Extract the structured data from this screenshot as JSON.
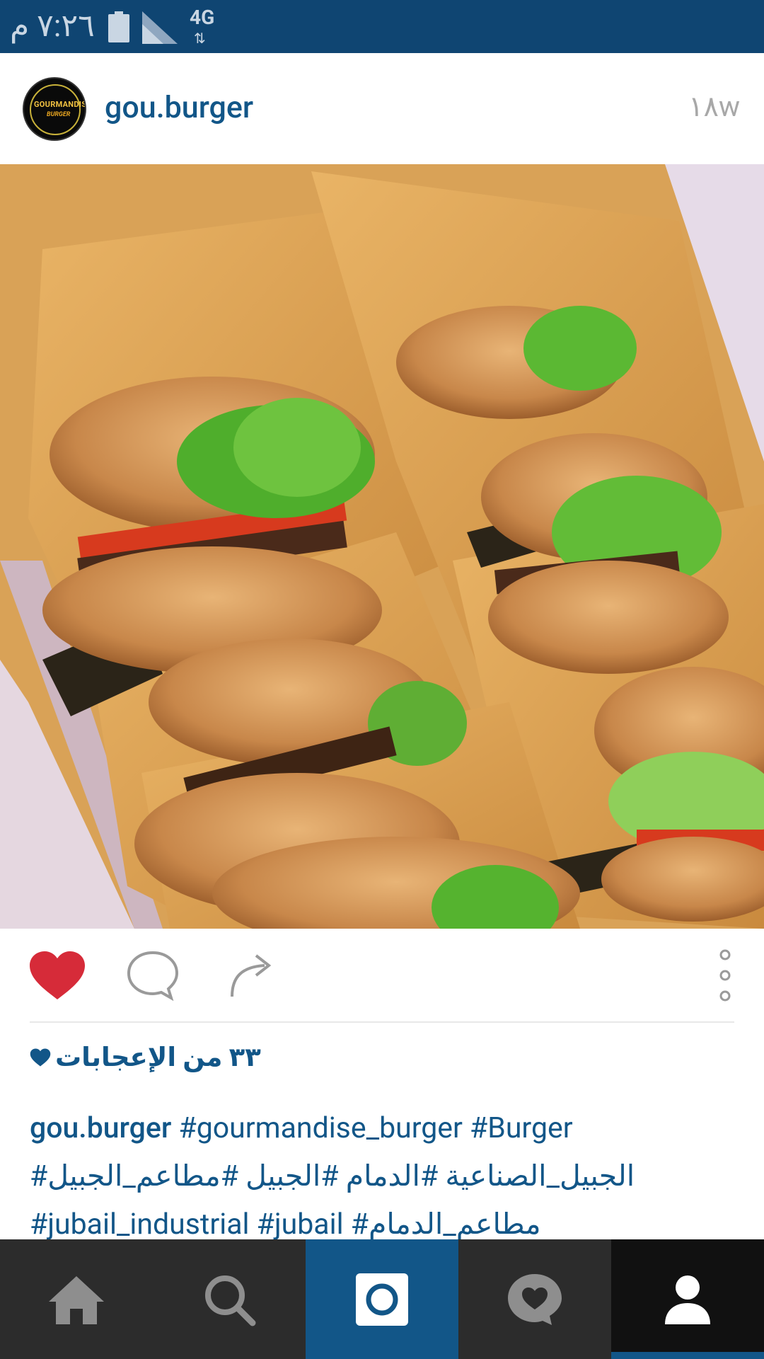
{
  "status_bar": {
    "time": "٧:٢٦ م",
    "network": "4G"
  },
  "post": {
    "username": "gou.burger",
    "age": "١٨w",
    "avatar": {
      "brand": "GOURMANDISE",
      "sub": "BURGER"
    },
    "likes": "٣٣ من الإعجابات",
    "caption": {
      "username": "gou.burger",
      "line1_tags": "#gourmandise_burger #Burger",
      "line2": "الجبيل_الصناعية #الدمام #الجبيل #مطاعم_الجبيل#",
      "line3": "#jubail_industrial #jubail #مطاعم_الدمام"
    }
  },
  "colors": {
    "status_bar": "#0f4572",
    "link": "#125688",
    "like_red": "#d62b39",
    "nav_bg": "#2c2c2c",
    "nav_active": "#125688"
  },
  "icons": {
    "like": "heart-icon",
    "comment": "comment-bubble-icon",
    "share": "share-arrow-icon",
    "more": "more-vertical-icon",
    "nav": [
      "home-icon",
      "search-icon",
      "camera-icon",
      "activity-heart-icon",
      "profile-icon"
    ]
  }
}
